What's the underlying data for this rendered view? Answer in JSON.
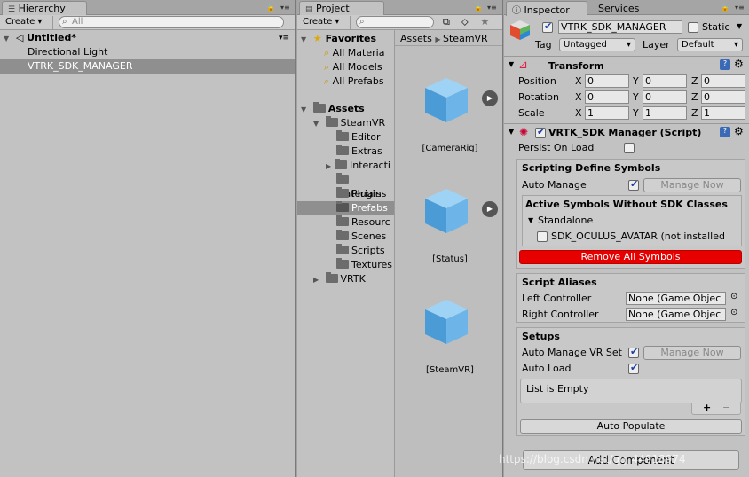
{
  "hierarchy": {
    "tab": "Hierarchy",
    "create": "Create ▾",
    "search_placeholder": "All",
    "scene": "Untitled*",
    "items": [
      "Directional Light",
      "VTRK_SDK_MANAGER"
    ]
  },
  "project": {
    "tab": "Project",
    "create": "Create ▾",
    "favorites": {
      "label": "Favorites",
      "items": [
        "All Materia",
        "All Models",
        "All Prefabs"
      ]
    },
    "assets": {
      "label": "Assets",
      "steamvr": "SteamVR",
      "children": [
        "Editor",
        "Extras",
        "Interacti",
        "Materials",
        "Plugins",
        "Prefabs",
        "Resourc",
        "Scenes",
        "Scripts",
        "Textures"
      ],
      "vrtk": "VRTK"
    },
    "breadcrumb": [
      "Assets",
      "SteamVR"
    ],
    "prefabs": [
      "[CameraRig]",
      "[Status]",
      "[SteamVR]"
    ]
  },
  "inspector": {
    "tab": "Inspector",
    "tab2": "Services",
    "object_name": "VTRK_SDK_MANAGER",
    "static_label": "Static",
    "tag_label": "Tag",
    "tag_value": "Untagged",
    "layer_label": "Layer",
    "layer_value": "Default",
    "transform": {
      "title": "Transform",
      "rows": [
        {
          "label": "Position",
          "x": "0",
          "y": "0",
          "z": "0"
        },
        {
          "label": "Rotation",
          "x": "0",
          "y": "0",
          "z": "0"
        },
        {
          "label": "Scale",
          "x": "1",
          "y": "1",
          "z": "1"
        }
      ],
      "axis": [
        "X",
        "Y",
        "Z"
      ]
    },
    "sdk_manager": {
      "title": "VRTK_SDK Manager (Script)",
      "persist": "Persist On Load",
      "define_title": "Scripting Define Symbols",
      "auto_manage": "Auto Manage",
      "manage_now": "Manage Now",
      "active_title": "Active Symbols Without SDK Classes",
      "standalone": "Standalone",
      "symbol": "SDK_OCULUS_AVATAR (not installed",
      "remove_all": "Remove All Symbols",
      "aliases_title": "Script Aliases",
      "left_ctrl": "Left Controller",
      "right_ctrl": "Right Controller",
      "none_obj": "None (Game Objec",
      "setups_title": "Setups",
      "auto_manage_vr": "Auto Manage VR Set",
      "auto_load": "Auto Load",
      "list_empty": "List is Empty",
      "plus": "+",
      "minus": "−",
      "auto_populate": "Auto Populate"
    },
    "add_component": "Add Component",
    "watermark": "https://blog.csdn.net/qq_44918974"
  },
  "colors": {
    "remove_btn": "#e60000",
    "selection": "#8f8f8f",
    "cube": "#5aa6e0"
  }
}
